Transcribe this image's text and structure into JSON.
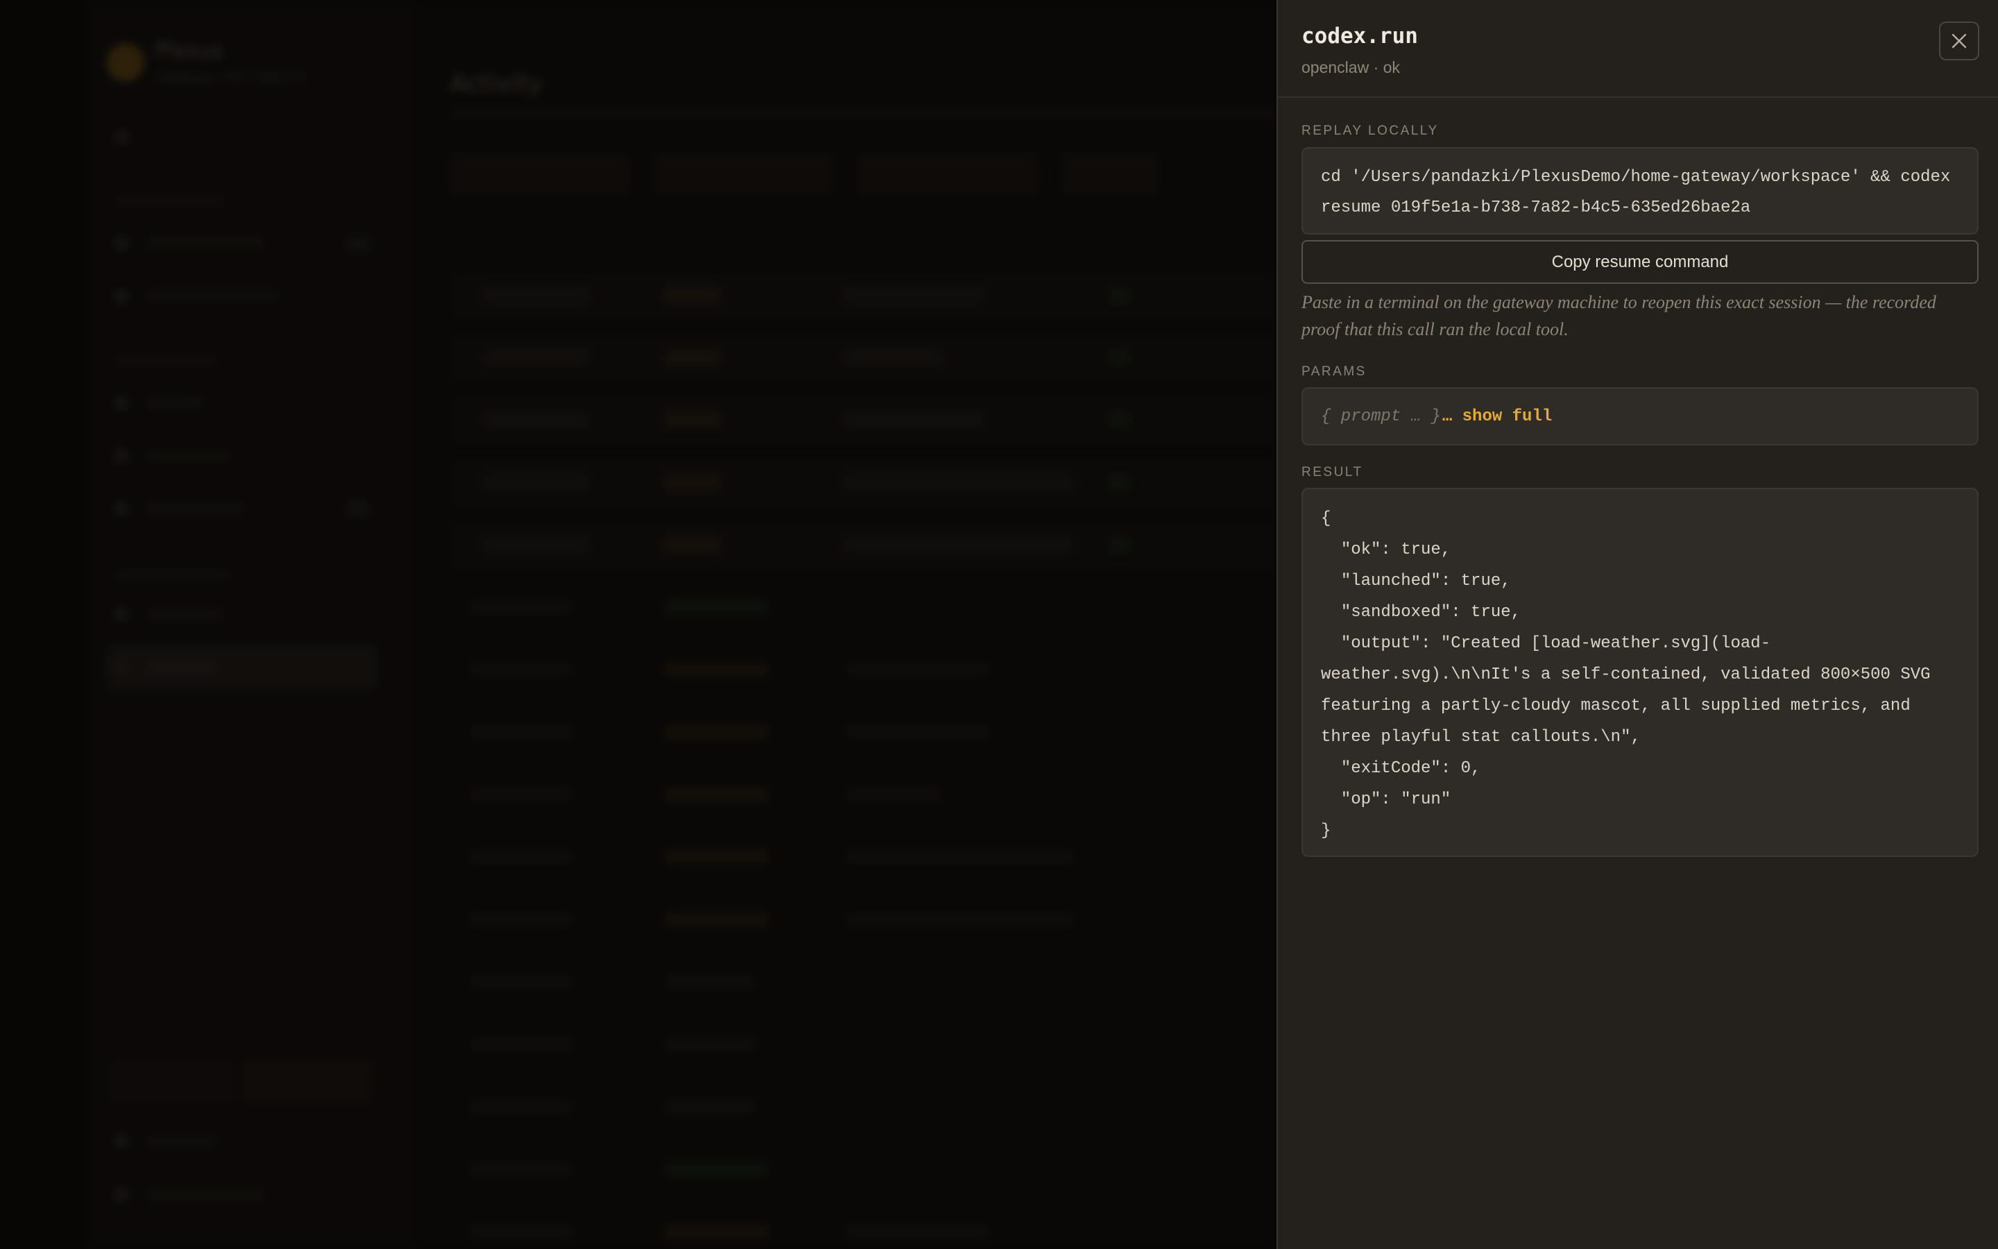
{
  "background": {
    "brand_name": "Plexus",
    "brand_sub": "Gateway 192.168.0.4",
    "page_title": "Activity"
  },
  "drawer": {
    "title": "codex.run",
    "subtitle": "openclaw · ok",
    "close_icon": "close-icon",
    "replay": {
      "label": "REPLAY LOCALLY",
      "command": "cd '/Users/pandazki/PlexusDemo/home-gateway/workspace' && codex resume 019f5e1a-b738-7a82-b4c5-635ed26bae2a",
      "copy_label": "Copy resume command",
      "hint": "Paste in a terminal on the gateway machine to reopen this exact session — the recorded proof that this call ran the local tool."
    },
    "params": {
      "label": "PARAMS",
      "preview": "{ prompt … }",
      "show_full_label": "… show full"
    },
    "result": {
      "label": "RESULT",
      "json": "{\n  \"ok\": true,\n  \"launched\": true,\n  \"sandboxed\": true,\n  \"output\": \"Created [load-weather.svg](load-weather.svg).\\n\\nIt's a self-contained, validated 800×500 SVG featuring a partly-cloudy mascot, all supplied metrics, and three playful stat callouts.\\n\",\n  \"exitCode\": 0,\n  \"op\": \"run\"\n}"
    }
  },
  "colors": {
    "accent": "#e5a93a",
    "drawer_bg": "#24211d",
    "code_bg": "#2f2b26"
  }
}
